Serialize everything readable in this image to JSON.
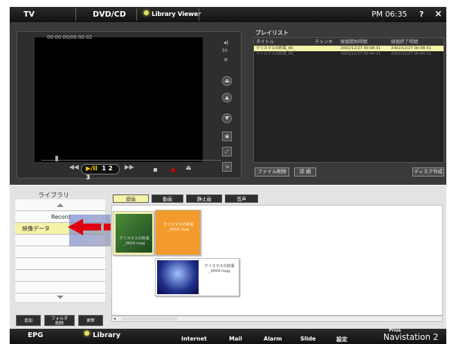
{
  "top_nav": {
    "tv": "TV",
    "dvd": "DVD/CD",
    "library_viewer": "Library Viewer",
    "clock": "PM 06:35",
    "help": "?",
    "close": "×"
  },
  "player": {
    "timecode": "00:00:00/00:00:02",
    "volume": "50",
    "play_label": "▶/II",
    "disc": "1 2 3",
    "rewind": "◀◀",
    "forward": "▶▶"
  },
  "playlist": {
    "title": "プレイリスト",
    "headers": [
      "タイトル",
      "チャンネ",
      "録画開始時間",
      "録画終了時間"
    ],
    "rows": [
      [
        "クリスマスの約束_80_",
        "",
        "2002/12/27 00:08:31",
        "2002/12/27 00:08:31"
      ],
      [
        "クリスマスの約束_80_",
        "",
        "2002/12/27 00:44:11",
        "2002/12/27 00:44:11"
      ]
    ],
    "buttons": {
      "delete": "ファイル削除",
      "detail": "詳 細",
      "disc": "ディスク作成"
    }
  },
  "library": {
    "title": "ライブラリ",
    "items": [
      "Record",
      "映像データ"
    ],
    "buttons": {
      "add": "追加",
      "folder_delete": "フォルダ\n削除",
      "update": "更新"
    },
    "tabs": [
      "録画",
      "動画",
      "静止画",
      "音声"
    ],
    "cards": [
      {
        "caption": "クリスマスの約束\n_0004.mpg"
      },
      {
        "caption": "クリスマスの約束\n_0002.mpg"
      },
      {
        "caption": "クリスマスの約束\n_0004.mpg"
      }
    ]
  },
  "bottom_nav": {
    "epg": "EPG",
    "library": "Library",
    "internet": "Internet",
    "mail": "Mail",
    "alarm": "Alarm",
    "slide": "Slide",
    "settings": "設定",
    "brand_small": "Prius",
    "brand": "Navistation 2"
  }
}
